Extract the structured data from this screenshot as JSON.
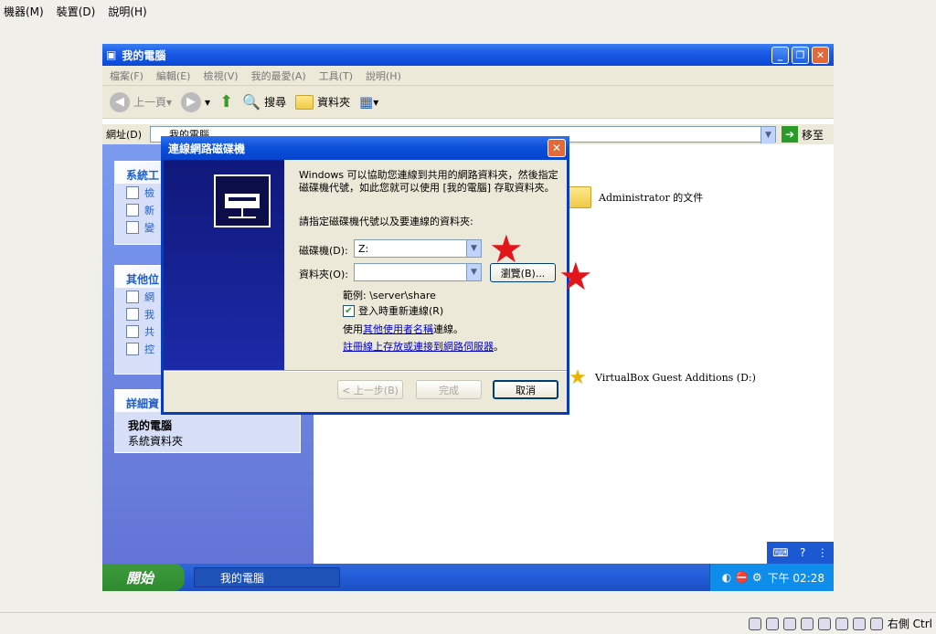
{
  "host": {
    "menu": [
      "機器(M)",
      "裝置(D)",
      "說明(H)"
    ],
    "status_text": "右側 Ctrl"
  },
  "explorer": {
    "title": "我的電腦",
    "menu": [
      "檔案(F)",
      "編輯(E)",
      "檢視(V)",
      "我的最愛(A)",
      "工具(T)",
      "說明(H)"
    ],
    "toolbar": {
      "back": "上一頁",
      "search": "搜尋",
      "folders": "資料夾"
    },
    "address_label": "網址(D)",
    "address_value": "我的電腦",
    "go": "移至",
    "panels": {
      "system_tasks": {
        "title": "系統工",
        "items": [
          "檢",
          "新",
          "變"
        ]
      },
      "other_places": {
        "title": "其他位",
        "items": [
          "網",
          "我",
          "共",
          "控"
        ]
      },
      "details": {
        "title": "詳細資",
        "name": "我的電腦",
        "desc": "系統資料夾"
      }
    },
    "content": {
      "item1": "Administrator 的文件",
      "item2": "VirtualBox Guest Additions (D:)"
    }
  },
  "taskbar": {
    "start": "開始",
    "task": "我的電腦",
    "clock": "下午 02:28"
  },
  "dialog": {
    "title": "連線網路磁碟機",
    "intro": "Windows 可以協助您連線到共用的網路資料夾，然後指定磁碟機代號，如此您就可以使用 [我的電腦] 存取資料夾。",
    "prompt": "請指定磁碟機代號以及要連線的資料夾:",
    "drive_label": "磁碟機(D):",
    "drive_value": "Z:",
    "folder_label": "資料夾(O):",
    "folder_value": "",
    "browse": "瀏覽(B)...",
    "example": "範例: \\server\\share",
    "reconnect": "登入時重新連線(R)",
    "use_prefix": "使用",
    "use_link": "其他使用者名稱",
    "use_suffix": "連線。",
    "signup_link": "註冊線上存放或連接到網路伺服器",
    "signup_suffix": "。",
    "back": "< 上一步(B)",
    "finish": "完成",
    "cancel": "取消"
  },
  "colors": {
    "xp_blue": "#0a48d6",
    "annotation_star": "#e2151b"
  }
}
